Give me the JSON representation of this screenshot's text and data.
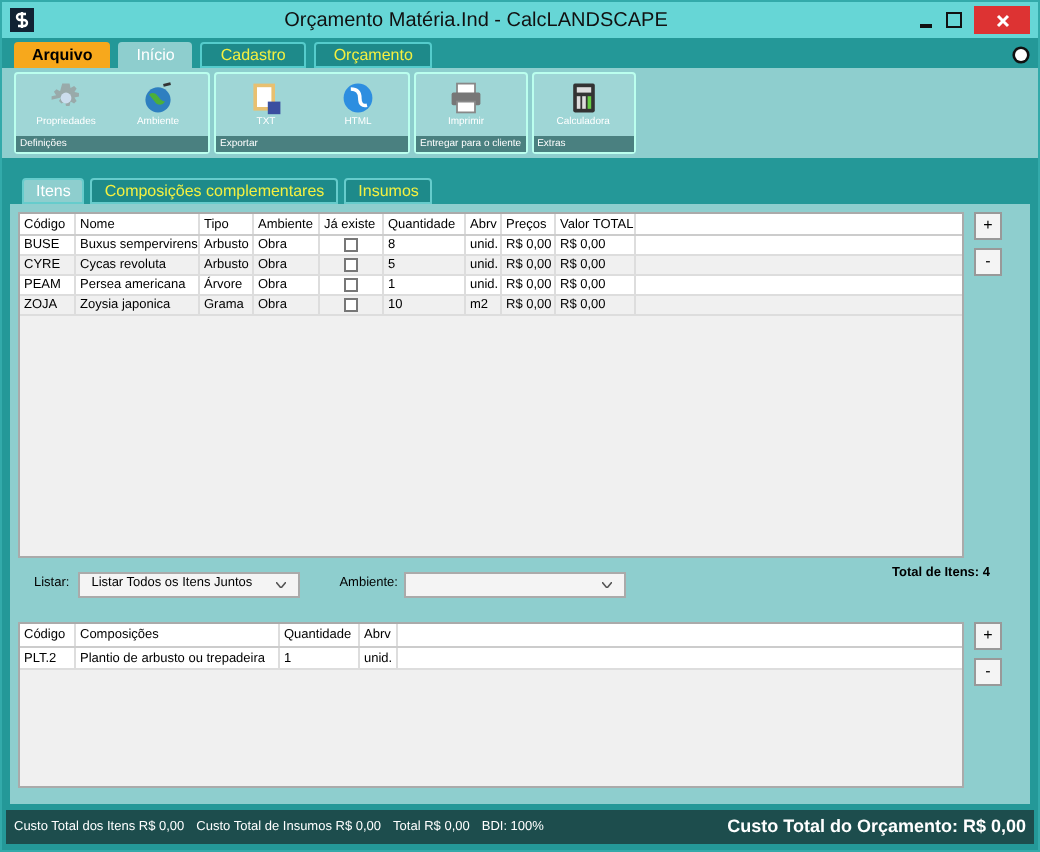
{
  "window": {
    "title": "Orçamento Matéria.Ind - CalcLANDSCAPE"
  },
  "file_menu": {
    "label": "Arquivo"
  },
  "menu_tabs": [
    {
      "label": "Início",
      "selected": true
    },
    {
      "label": "Cadastro",
      "selected": false
    },
    {
      "label": "Orçamento",
      "selected": false
    }
  ],
  "ribbon_groups": [
    {
      "label": "Definições",
      "items": [
        {
          "label": "Propriedades",
          "kind": "gear"
        },
        {
          "label": "Ambiente",
          "kind": "globe"
        }
      ]
    },
    {
      "label": "Exportar",
      "items": [
        {
          "label": "TXT",
          "kind": "txt"
        },
        {
          "label": "HTML",
          "kind": "html"
        }
      ]
    },
    {
      "label": "Entregar para o cliente",
      "items": [
        {
          "label": "Imprimir",
          "kind": "printer"
        }
      ]
    },
    {
      "label": "Extras",
      "items": [
        {
          "label": "Calculadora",
          "kind": "calculator"
        }
      ]
    }
  ],
  "tabs": [
    {
      "label": "Itens",
      "selected": true
    },
    {
      "label": "Composições complementares",
      "selected": false
    },
    {
      "label": "Insumos",
      "selected": false
    }
  ],
  "items_table": {
    "columns": [
      "Código",
      "Nome",
      "Tipo",
      "Ambiente",
      "Já existe",
      "Quantidade",
      "Abrv",
      "Preços",
      "Valor TOTAL"
    ],
    "rows": [
      {
        "cells": [
          "BUSE",
          "Buxus sempervirens",
          "Arbusto",
          "Obra",
          {
            "kind": "checkbox",
            "checked": false
          },
          "8",
          "unid.",
          "R$ 0,00",
          "R$ 0,00"
        ]
      },
      {
        "cells": [
          "CYRE",
          "Cycas revoluta",
          "Arbusto",
          "Obra",
          {
            "kind": "checkbox",
            "checked": false
          },
          "5",
          "unid.",
          "R$ 0,00",
          "R$ 0,00"
        ]
      },
      {
        "cells": [
          "PEAM",
          "Persea americana",
          "Árvore",
          "Obra",
          {
            "kind": "checkbox",
            "checked": false
          },
          "1",
          "unid.",
          "R$ 0,00",
          "R$ 0,00"
        ]
      },
      {
        "cells": [
          "ZOJA",
          "Zoysia japonica",
          "Grama",
          "Obra",
          {
            "kind": "checkbox",
            "checked": false
          },
          "10",
          "m2",
          "R$ 0,00",
          "R$ 0,00"
        ]
      }
    ]
  },
  "side_buttons": [
    "+",
    "-"
  ],
  "filters": {
    "list_label": "Listar:",
    "list_value": "Listar Todos os Itens Juntos",
    "ambiente_label": "Ambiente:",
    "total": "Total de Itens: 4"
  },
  "compositions_table": {
    "columns": [
      "Código",
      "Composições",
      "Quantidade",
      "Abrv"
    ],
    "rows": [
      [
        "PLT.2",
        "Plantio de arbusto ou trepadeira",
        "1",
        "unid."
      ]
    ]
  },
  "side_buttons_2": [
    "+",
    "-"
  ],
  "status_bar": {
    "items": [
      "Custo Total dos Itens R$ 0,00",
      "Custo Total de Insumos R$ 0,00",
      "Total R$ 0,00",
      "BDI: 100%"
    ],
    "total": "Custo Total do Orçamento: R$ 0,00"
  }
}
